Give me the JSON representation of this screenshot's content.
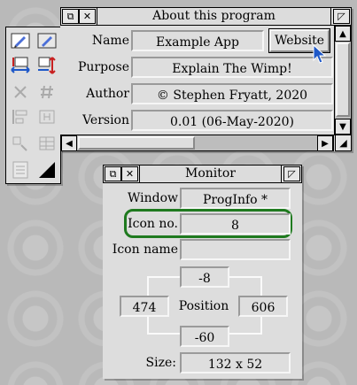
{
  "about": {
    "title": "About this program",
    "rows": [
      {
        "label": "Name",
        "value": "Example App"
      },
      {
        "label": "Purpose",
        "value": "Explain The Wimp!"
      },
      {
        "label": "Author",
        "value": "© Stephen Fryatt, 2020"
      },
      {
        "label": "Version",
        "value": "0.01 (06-May-2020)"
      }
    ],
    "website_button": "Website"
  },
  "monitor": {
    "title": "Monitor",
    "window_label": "Window",
    "window_value": "ProgInfo *",
    "icon_no_label": "Icon no.",
    "icon_no_value": "8",
    "icon_name_label": "Icon name",
    "icon_name_value": "",
    "position_label": "Position",
    "pos_top": "-8",
    "pos_left": "474",
    "pos_right": "606",
    "pos_bottom": "-60",
    "size_label": "Size:",
    "size_value": "132 x 52"
  },
  "colors": {
    "highlight": "#1f7a1f",
    "window_bg": "#dddddd",
    "pointer": "#1e58c8"
  },
  "icons": {
    "toolbox": [
      "edit-icon",
      "edit-alt-icon",
      "move-icon",
      "move-resize-icon",
      "cross-icon",
      "hash-icon",
      "align-left-icon",
      "align-horizontal-icon",
      "resize-corner-icon",
      "grid-icon",
      "list-icon",
      "black-triangle-icon"
    ],
    "pointer": "mouse-pointer-icon"
  }
}
